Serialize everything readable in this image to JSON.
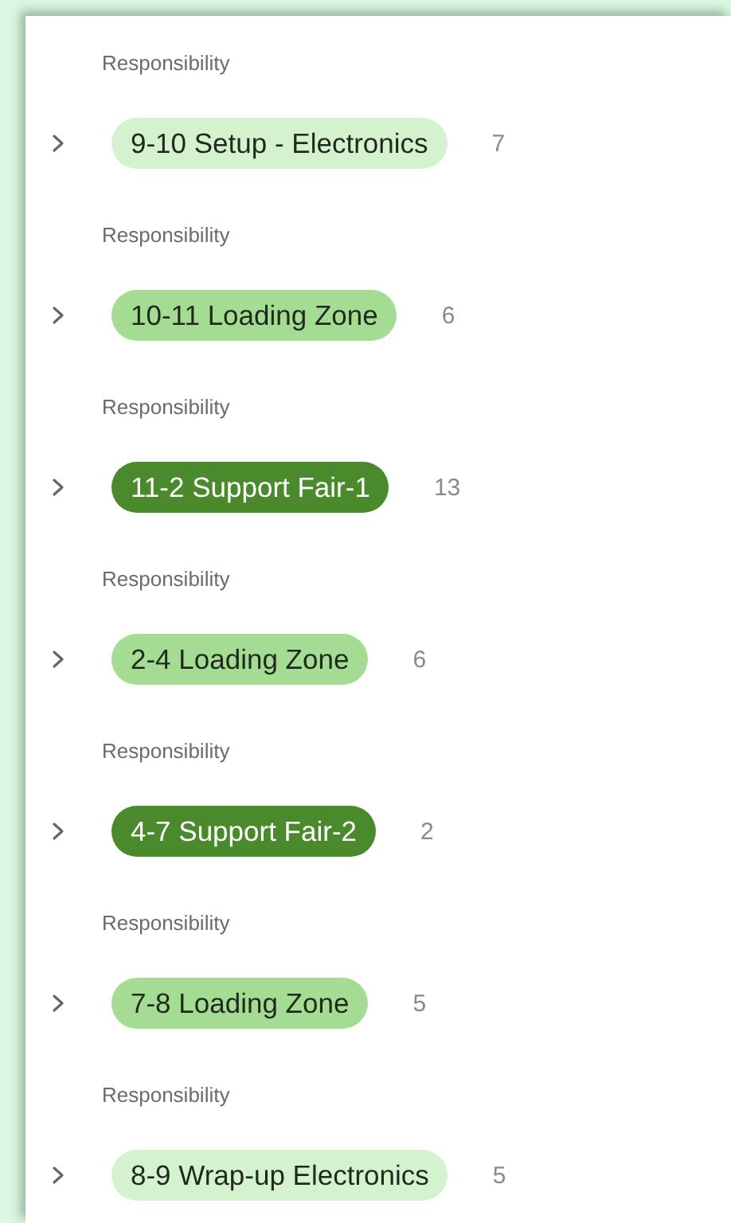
{
  "groups": [
    {
      "label": "Responsibility",
      "tag": "9-10 Setup - Electronics",
      "color": "#d5f2cf",
      "count": "7",
      "expanded": false
    },
    {
      "label": "Responsibility",
      "tag": "10-11 Loading Zone",
      "color": "#a5dc94",
      "count": "6",
      "expanded": false
    },
    {
      "label": "Responsibility",
      "tag": "11-2 Support Fair-1",
      "color": "#4b892d",
      "count": "13",
      "expanded": false
    },
    {
      "label": "Responsibility",
      "tag": "2-4 Loading Zone",
      "color": "#a5dc94",
      "count": "6",
      "expanded": false
    },
    {
      "label": "Responsibility",
      "tag": "4-7 Support Fair-2",
      "color": "#4b892d",
      "count": "2",
      "expanded": false
    },
    {
      "label": "Responsibility",
      "tag": "7-8 Loading Zone",
      "color": "#a5dc94",
      "count": "5",
      "expanded": false
    },
    {
      "label": "Responsibility",
      "tag": "8-9 Wrap-up Electronics",
      "color": "#d5f2cf",
      "count": "5",
      "expanded": false
    }
  ]
}
